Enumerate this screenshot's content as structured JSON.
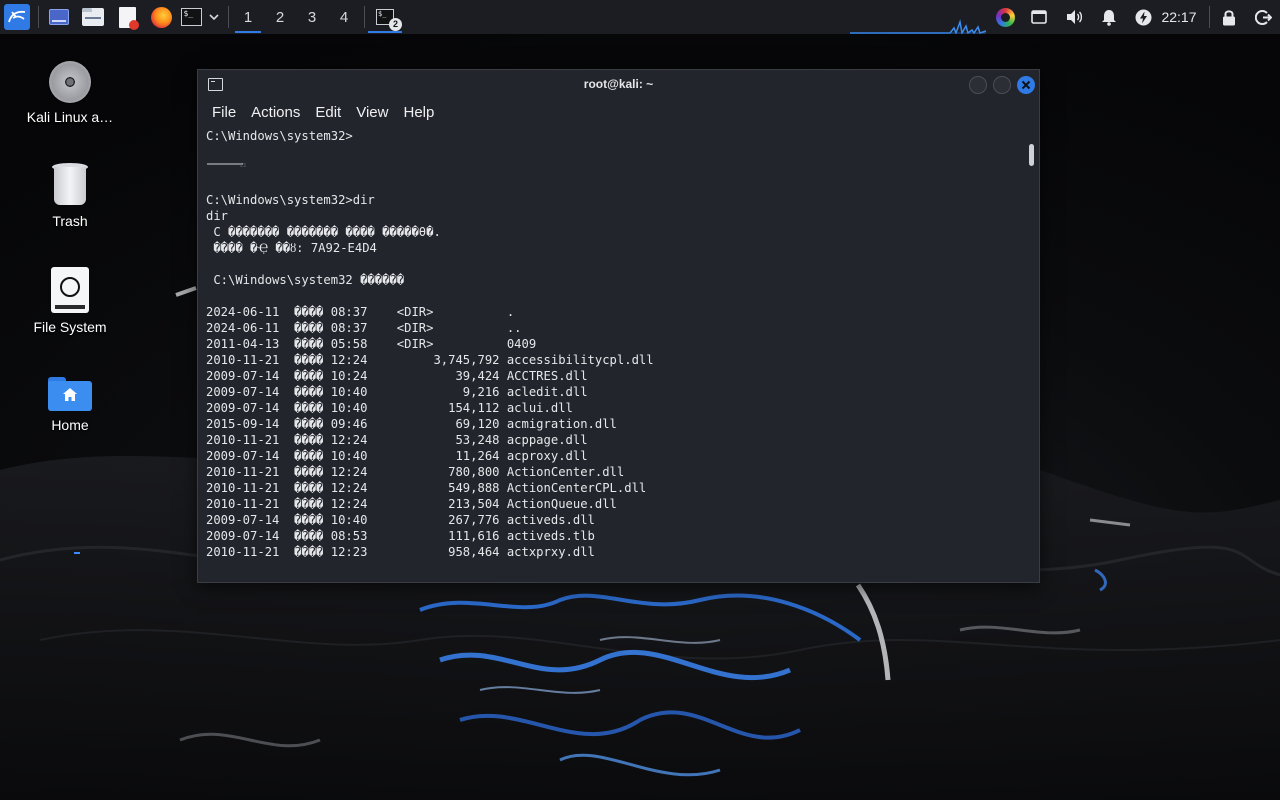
{
  "panel": {
    "launchers": [
      "kali-menu-icon",
      "desktop-icon",
      "files-icon",
      "text-editor-icon",
      "firefox-icon",
      "terminal-icon",
      "launcher-dropdown-icon"
    ],
    "workspaces": [
      "1",
      "2",
      "3",
      "4"
    ],
    "active_workspace": "1",
    "task_badge": "2",
    "clock": "22:17"
  },
  "desktop": {
    "icons": [
      {
        "label": "Kali Linux a…",
        "icon": "optical-disc-icon"
      },
      {
        "label": "Trash",
        "icon": "trash-icon"
      },
      {
        "label": "File System",
        "icon": "drive-icon"
      },
      {
        "label": "Home",
        "icon": "home-folder-icon"
      }
    ]
  },
  "terminal": {
    "title": "root@kali: ~",
    "menu": [
      "File",
      "Actions",
      "Edit",
      "View",
      "Help"
    ],
    "lines": [
      "C:\\Windows\\system32>",
      "",
      "",
      "",
      "C:\\Windows\\system32>dir",
      "dir",
      " C ������� ������� ���� �����θ�.",
      " ���� �Ҿ ��ȣ: 7A92-E4D4",
      "",
      " C:\\Windows\\system32 �����͸�",
      "",
      "2024-06-11  ���� 08:37    <DIR>          .",
      "2024-06-11  ���� 08:37    <DIR>          ..",
      "2011-04-13  ���� 05:58    <DIR>          0409",
      "2010-11-21  ���� 12:24         3,745,792 accessibilitycpl.dll",
      "2009-07-14  ���� 10:24            39,424 ACCTRES.dll",
      "2009-07-14  ���� 10:40             9,216 acledit.dll",
      "2009-07-14  ���� 10:40           154,112 aclui.dll",
      "2015-09-14  ���� 09:46            69,120 acmigration.dll",
      "2010-11-21  ���� 12:24            53,248 acppage.dll",
      "2009-07-14  ���� 10:40            11,264 acproxy.dll",
      "2010-11-21  ���� 12:24           780,800 ActionCenter.dll",
      "2010-11-21  ���� 12:24           549,888 ActionCenterCPL.dll",
      "2010-11-21  ���� 12:24           213,504 ActionQueue.dll",
      "2009-07-14  ���� 10:40           267,776 activeds.dll",
      "2009-07-14  ���� 08:53           111,616 activeds.tlb",
      "2010-11-21  ���� 12:23           958,464 actxprxy.dll"
    ]
  },
  "colors": {
    "panel_bg": "#1b1d22",
    "terminal_bg": "#22252c",
    "accent": "#2f7ae5",
    "close_button": "#2f7ae5",
    "folder_blue": "#3b8ef0"
  }
}
